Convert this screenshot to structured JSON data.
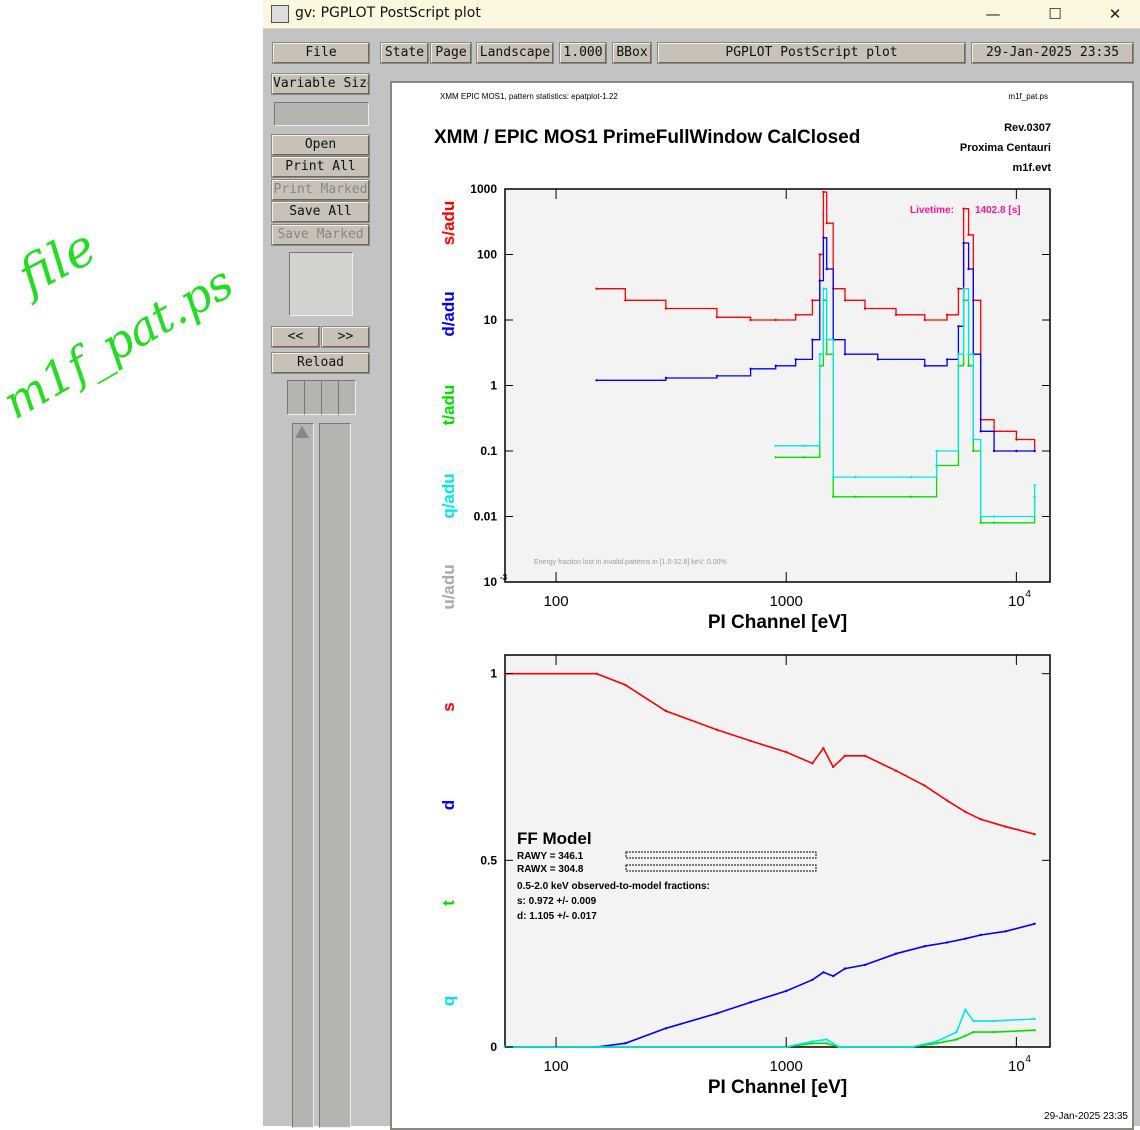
{
  "annotation": {
    "line1": "file",
    "line2": "m1f_pat.ps"
  },
  "window": {
    "title": "gv: PGPLOT PostScript plot",
    "minimize": "—",
    "maximize": "☐",
    "close": "✕"
  },
  "toolbar": {
    "file": "File",
    "state": "State",
    "page": "Page",
    "orientation": "Landscape",
    "scale": "1.000",
    "bbox": "BBox",
    "doc_title": "PGPLOT PostScript plot",
    "date": "29-Jan-2025 23:35"
  },
  "left_panel": {
    "size_mode": "Variable Size",
    "open": "Open",
    "print_all": "Print All",
    "print_marked": "Print Marked",
    "save_all": "Save All",
    "save_marked": "Save Marked",
    "prev": "<<",
    "next": ">>",
    "reload": "Reload"
  },
  "plot": {
    "header_left": "XMM EPIC MOS1, pattern statistics: epatplot-1.22",
    "header_right": "m1f_pat.ps",
    "title": "XMM / EPIC MOS1 PrimeFullWindow CalClosed",
    "rev": "Rev.0307",
    "target": "Proxima Centauri",
    "evt": "m1f.evt",
    "livetime_label": "Livetime:",
    "livetime_value": "1402.8 [s]",
    "energy_note": "Energy fraction lost in invalid patterns in [1.0-32.8] keV: 0.00%",
    "ylabels_top": [
      {
        "text": "s/adu",
        "color": "#ff0000"
      },
      {
        "text": "d/adu",
        "color": "#0000ff"
      },
      {
        "text": "t/adu",
        "color": "#00e000"
      },
      {
        "text": "q/adu",
        "color": "#00e8e8"
      },
      {
        "text": "u/adu",
        "color": "#aaaaaa"
      }
    ],
    "ylabels_bottom": [
      {
        "text": "s",
        "color": "#ff0000"
      },
      {
        "text": "d",
        "color": "#0000ff"
      },
      {
        "text": "t",
        "color": "#00e000"
      },
      {
        "text": "q",
        "color": "#00e8e8"
      }
    ],
    "top_yticks": [
      "1000",
      "100",
      "10",
      "1",
      "0.1",
      "0.01",
      "10"
    ],
    "top_ytick_exp": "-3",
    "xticks": [
      "100",
      "1000",
      "10"
    ],
    "xtick_exp": "4",
    "xlabel": "PI Channel [eV]",
    "bottom_yticks": [
      "1",
      "0.5",
      "0"
    ],
    "ff_model": "FF Model",
    "rawy": "RAWY = 346.1",
    "rawx": "RAWX = 304.8",
    "fraction_title": "0.5-2.0 keV observed-to-model fractions:",
    "fraction_s": "s: 0.972 +/- 0.009",
    "fraction_d": "d: 1.105 +/- 0.017",
    "footer_date": "29-Jan-2025 23:35"
  },
  "chart_data": [
    {
      "type": "line",
      "title": "XMM / EPIC MOS1 PrimeFullWindow CalClosed",
      "xlabel": "PI Channel [eV]",
      "ylabel": "s/adu d/adu t/adu q/adu u/adu",
      "xscale": "log",
      "yscale": "log",
      "xlim": [
        60,
        14000
      ],
      "ylim": [
        0.001,
        1000
      ],
      "series": [
        {
          "name": "s",
          "color": "#ff0000",
          "x": [
            150,
            200,
            300,
            500,
            700,
            900,
            1100,
            1300,
            1400,
            1450,
            1500,
            1600,
            1800,
            2200,
            3000,
            4000,
            5000,
            5600,
            5900,
            6200,
            6500,
            7000,
            8000,
            10000,
            12000
          ],
          "y": [
            30,
            20,
            15,
            11,
            10,
            10,
            12,
            20,
            100,
            900,
            300,
            30,
            20,
            15,
            12,
            10,
            12,
            30,
            500,
            200,
            20,
            0.3,
            0.2,
            0.15,
            0.1
          ]
        },
        {
          "name": "d",
          "color": "#0000ff",
          "x": [
            150,
            300,
            500,
            700,
            900,
            1100,
            1300,
            1400,
            1450,
            1500,
            1600,
            1800,
            2500,
            4000,
            5000,
            5600,
            5900,
            6200,
            6500,
            7000,
            8000,
            10000,
            12000
          ],
          "y": [
            1.2,
            1.3,
            1.4,
            1.8,
            2,
            2.5,
            5,
            40,
            180,
            60,
            5,
            3,
            2.5,
            2,
            2.5,
            8,
            150,
            60,
            3,
            0.2,
            0.1,
            0.1,
            0.1
          ]
        },
        {
          "name": "t",
          "color": "#00e000",
          "x": [
            900,
            1200,
            1400,
            1450,
            1500,
            1600,
            2000,
            3500,
            4500,
            5600,
            5900,
            6200,
            6500,
            7000,
            8000,
            12000
          ],
          "y": [
            0.08,
            0.08,
            2,
            20,
            3,
            0.02,
            0.02,
            0.02,
            0.06,
            2,
            20,
            2,
            0.1,
            0.008,
            0.008,
            0.02
          ]
        },
        {
          "name": "q",
          "color": "#00e8e8",
          "x": [
            900,
            1200,
            1400,
            1450,
            1500,
            1600,
            2000,
            3500,
            4500,
            5600,
            5900,
            6200,
            6500,
            7000,
            8000,
            12000
          ],
          "y": [
            0.12,
            0.12,
            3,
            30,
            5,
            0.04,
            0.04,
            0.04,
            0.1,
            3,
            30,
            3,
            0.15,
            0.01,
            0.01,
            0.03
          ]
        }
      ]
    },
    {
      "type": "line",
      "xlabel": "PI Channel [eV]",
      "ylabel": "s d t q",
      "xscale": "log",
      "xlim": [
        60,
        14000
      ],
      "ylim": [
        0,
        1.05
      ],
      "series": [
        {
          "name": "s",
          "color": "#ff0000",
          "x": [
            60,
            150,
            200,
            300,
            500,
            700,
            1000,
            1300,
            1450,
            1600,
            1800,
            2200,
            3000,
            4000,
            5000,
            6000,
            7000,
            9000,
            12000
          ],
          "y": [
            1,
            1,
            0.97,
            0.9,
            0.85,
            0.82,
            0.79,
            0.76,
            0.8,
            0.75,
            0.78,
            0.78,
            0.74,
            0.7,
            0.66,
            0.63,
            0.61,
            0.59,
            0.57
          ]
        },
        {
          "name": "d",
          "color": "#0000ff",
          "x": [
            60,
            150,
            200,
            300,
            500,
            700,
            1000,
            1300,
            1450,
            1600,
            1800,
            2200,
            3000,
            4000,
            5000,
            6000,
            7000,
            9000,
            12000
          ],
          "y": [
            0,
            0,
            0.01,
            0.05,
            0.09,
            0.12,
            0.15,
            0.18,
            0.2,
            0.19,
            0.21,
            0.22,
            0.25,
            0.27,
            0.28,
            0.29,
            0.3,
            0.31,
            0.33
          ]
        },
        {
          "name": "t",
          "color": "#00e000",
          "x": [
            60,
            1000,
            1300,
            1500,
            1700,
            3500,
            4500,
            5500,
            6000,
            6500,
            8000,
            12000
          ],
          "y": [
            0,
            0,
            0.01,
            0.01,
            0,
            0,
            0.01,
            0.02,
            0.03,
            0.04,
            0.04,
            0.045
          ]
        },
        {
          "name": "q",
          "color": "#00e8e8",
          "x": [
            60,
            1000,
            1300,
            1500,
            1700,
            3500,
            4500,
            5500,
            6000,
            6500,
            8000,
            12000
          ],
          "y": [
            0,
            0,
            0.015,
            0.02,
            0,
            0,
            0.015,
            0.04,
            0.1,
            0.07,
            0.07,
            0.075
          ]
        }
      ]
    }
  ]
}
